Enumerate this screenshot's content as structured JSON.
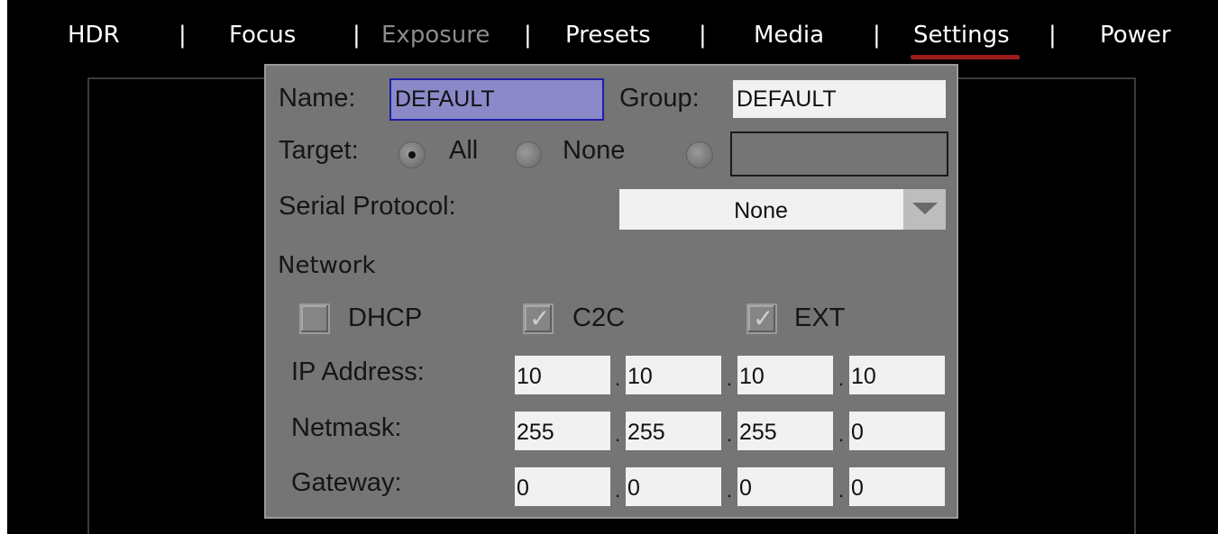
{
  "nav": {
    "tabs": [
      "HDR",
      "Focus",
      "Exposure",
      "Presets",
      "Media",
      "Settings",
      "Power"
    ],
    "separator": "|",
    "active_tab": "Settings",
    "disabled_tab": "Exposure",
    "accent_color": "#9c1c1c"
  },
  "dialog": {
    "name_label": "Name:",
    "name_value": "DEFAULT",
    "group_label": "Group:",
    "group_value": "DEFAULT",
    "target_label": "Target:",
    "target_options": [
      "All",
      "None"
    ],
    "target_selected": "All",
    "target_custom_value": "",
    "serial_label": "Serial Protocol:",
    "serial_value": "None",
    "network_heading": "Network",
    "checkboxes": [
      {
        "label": "DHCP",
        "checked": false
      },
      {
        "label": "C2C",
        "checked": true
      },
      {
        "label": "EXT",
        "checked": true
      }
    ],
    "ip_label": "IP Address:",
    "ip": [
      "10",
      "10",
      "10",
      "10"
    ],
    "netmask_label": "Netmask:",
    "netmask": [
      "255",
      "255",
      "255",
      "0"
    ],
    "gateway_label": "Gateway:",
    "gateway": [
      "0",
      "0",
      "0",
      "0"
    ],
    "octet_separator": "."
  }
}
